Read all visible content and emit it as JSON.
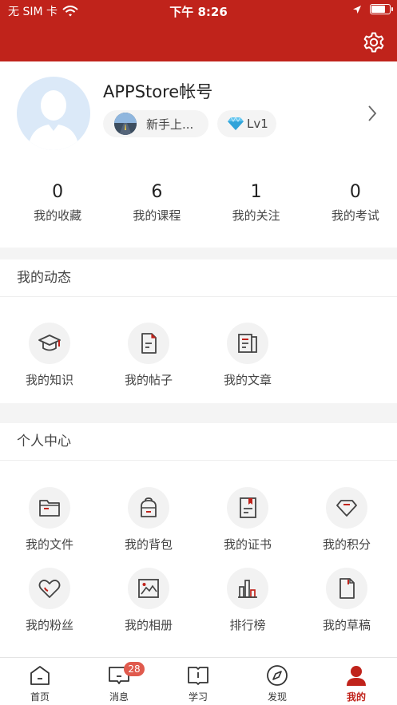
{
  "status_bar": {
    "carrier": "无 SIM 卡",
    "time": "下午 8:26",
    "battery_level": 0.85
  },
  "header": {
    "settings_icon": "gear-icon",
    "accent_color": "#c0231b"
  },
  "profile": {
    "username": "APPStore帐号",
    "rank_label": "新手上...",
    "level_label": "Lv1"
  },
  "stats": [
    {
      "value": "0",
      "label": "我的收藏"
    },
    {
      "value": "6",
      "label": "我的课程"
    },
    {
      "value": "1",
      "label": "我的关注"
    },
    {
      "value": "0",
      "label": "我的考试"
    }
  ],
  "dynamics": {
    "title": "我的动态",
    "items": [
      {
        "label": "我的知识",
        "icon": "mortarboard-icon"
      },
      {
        "label": "我的帖子",
        "icon": "post-icon"
      },
      {
        "label": "我的文章",
        "icon": "article-icon"
      }
    ]
  },
  "personal_center": {
    "title": "个人中心",
    "items": [
      {
        "label": "我的文件",
        "icon": "folder-icon"
      },
      {
        "label": "我的背包",
        "icon": "backpack-icon"
      },
      {
        "label": "我的证书",
        "icon": "certificate-icon"
      },
      {
        "label": "我的积分",
        "icon": "diamond-icon"
      },
      {
        "label": "我的粉丝",
        "icon": "heart-icon"
      },
      {
        "label": "我的相册",
        "icon": "photo-icon"
      },
      {
        "label": "排行榜",
        "icon": "bar-chart-icon"
      },
      {
        "label": "我的草稿",
        "icon": "draft-icon"
      }
    ]
  },
  "tabbar": {
    "items": [
      {
        "label": "首页",
        "icon": "home-icon"
      },
      {
        "label": "消息",
        "icon": "message-icon",
        "badge": "28"
      },
      {
        "label": "学习",
        "icon": "book-icon"
      },
      {
        "label": "发现",
        "icon": "compass-icon"
      },
      {
        "label": "我的",
        "icon": "user-icon"
      }
    ],
    "active": "我的"
  }
}
